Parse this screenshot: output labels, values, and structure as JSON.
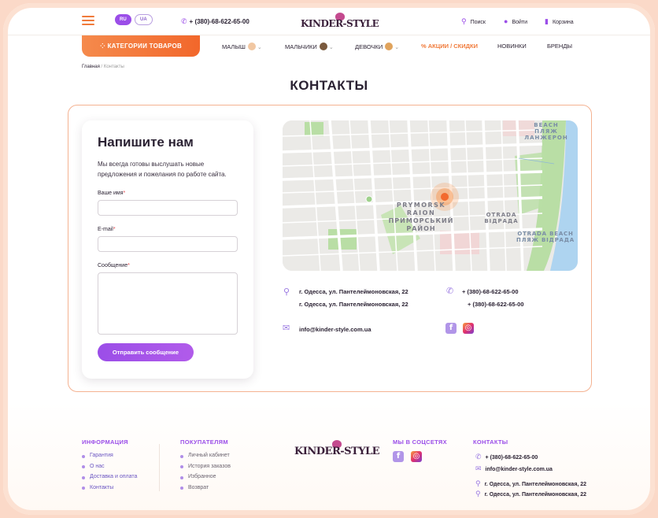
{
  "header": {
    "langs": [
      "RU",
      "UA"
    ],
    "phone": "+ (380)-68-622-65-00",
    "logo": "KINDER-STYLE",
    "search": "Поиск",
    "login": "Войти",
    "cart": "Корзина"
  },
  "nav": {
    "catalog": "КАТЕГОРИИ ТОВАРОВ",
    "items": [
      "МАЛЫШ",
      "МАЛЬЧИКИ",
      "ДЕВОЧКИ",
      "АКЦИИ / СКИДКИ",
      "НОВИНКИ",
      "БРЕНДЫ"
    ]
  },
  "breadcrumb": {
    "home": "Главная",
    "sep": " / ",
    "current": "Контакты"
  },
  "page_title": "КОНТАКТЫ",
  "form": {
    "title": "Напишите нам",
    "subtitle": "Мы всегда готовы выслушать новые предложения и пожелания по работе сайта.",
    "name_label": "Ваше имя",
    "email_label": "E-mail",
    "message_label": "Сообщение",
    "required": "*",
    "submit": "Отправить сообщение"
  },
  "map": {
    "labels": {
      "district_en1": "PRYMORSK",
      "district_en2": "RAION",
      "district_ua1": "ПРИМОРСЬКИЙ",
      "district_ua2": "РАЙОН",
      "beach1": "BEACH",
      "beach2": "ПЛЯЖ",
      "beach3": "ЛАНЖЕРОН",
      "otrada1": "OTRADA",
      "otrada2": "ВІДРАДА",
      "otrada3": "OTRADA BEACH",
      "otrada4": "ПЛЯЖ ВІДРАДА"
    }
  },
  "contacts": {
    "address1": "г. Одесса, ул. Пантелеймоновская, 22",
    "address2": "г. Одесса, ул. Пантелеймоновская, 22",
    "phone1": "+ (380)-68-622-65-00",
    "phone2": "+ (380)-68-622-65-00",
    "email": "info@kinder-style.com.ua"
  },
  "footer": {
    "info_title": "ИНФОРМАЦИЯ",
    "info_items": [
      "Гарантия",
      "О нас",
      "Доставка и оплата",
      "Контакты"
    ],
    "buyers_title": "ПОКУПАТЕЛЯМ",
    "buyers_items": [
      "Личный кабинет",
      "История заказов",
      "Избранное",
      "Возврат"
    ],
    "logo": "KINDER-STYLE",
    "social_title": "МЫ В СОЦСЕТЯХ",
    "contacts_title": "КОНТАКТЫ",
    "phone": "+ (380)-68-622-65-00",
    "email": "info@kinder-style.com.ua",
    "address1": "г. Одесса, ул. Пантелеймоновская, 22",
    "address2": "г. Одесса, ул. Пантелеймоновская, 22"
  },
  "colors": {
    "accent": "#9b4ee8",
    "orange": "#f2672b",
    "border": "#f4b291"
  }
}
